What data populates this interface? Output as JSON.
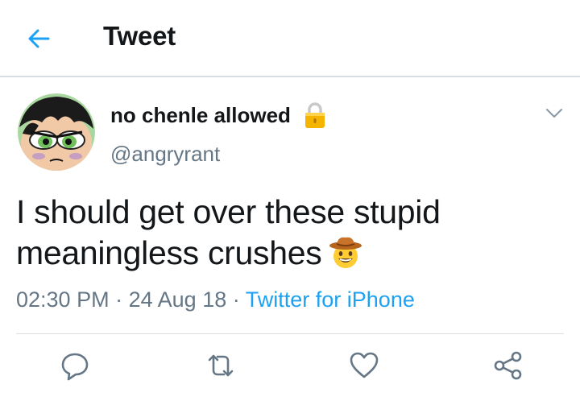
{
  "header": {
    "title": "Tweet",
    "back_icon": "back-arrow-icon"
  },
  "user": {
    "display_name": "no chenle allowed",
    "handle": "@angryrant",
    "protected_icon": "lock-icon"
  },
  "tweet": {
    "text": "I should get over these stupid meaningless crushes",
    "emoji": "cowboy-hat-face-emoji",
    "time": "02:30 PM",
    "date": "24 Aug 18",
    "source": "Twitter for iPhone",
    "separator": "·"
  },
  "actions": [
    "reply-icon",
    "retweet-icon",
    "like-icon",
    "share-icon"
  ],
  "colors": {
    "accent": "#1da1f2",
    "text": "#14171a",
    "secondary": "#657786"
  }
}
